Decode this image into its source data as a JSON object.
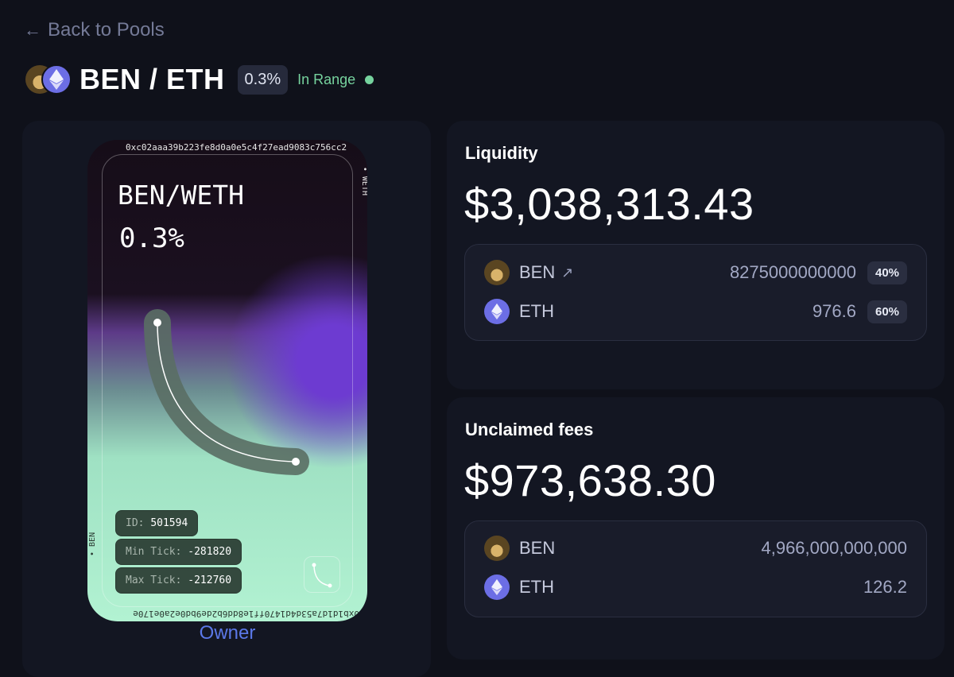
{
  "nav": {
    "back_label": "Back to Pools"
  },
  "pool": {
    "title": "BEN / ETH",
    "fee_tier": "0.3%",
    "status": "In Range",
    "status_color": "#76d39e"
  },
  "nft": {
    "address_top": "0xc02aaa39b223fe8d0a0e5c4f27ead9083c756cc2",
    "side_top_right": "• WETH",
    "address_bottom": "0xb1d1d7a53d4d1470ff1e8dd6b2de9bd0e2a0e170e",
    "side_bottom_left": "• BEN",
    "title": "BEN/WETH",
    "fee": "0.3%",
    "id_label": "ID:",
    "id_value": "501594",
    "min_tick_label": "Min Tick:",
    "min_tick_value": "-281820",
    "max_tick_label": "Max Tick:",
    "max_tick_value": "-212760",
    "owner_label": "Owner"
  },
  "liquidity": {
    "label": "Liquidity",
    "value": "$3,038,313.43",
    "tokens": [
      {
        "symbol": "BEN",
        "icon": "ben-token-icon",
        "external_link_icon": "external-link-icon",
        "amount": "8275000000000",
        "percent": "40%"
      },
      {
        "symbol": "ETH",
        "icon": "eth-token-icon",
        "amount": "976.6",
        "percent": "60%"
      }
    ]
  },
  "fees": {
    "label": "Unclaimed fees",
    "value": "$973,638.30",
    "tokens": [
      {
        "symbol": "BEN",
        "icon": "ben-token-icon",
        "amount": "4,966,000,000,000"
      },
      {
        "symbol": "ETH",
        "icon": "eth-token-icon",
        "amount": "126.2"
      }
    ]
  },
  "colors": {
    "background": "#0f111a",
    "card": "#131622",
    "accent_link": "#5b78e8",
    "eth_purple": "#6c6ee5"
  }
}
